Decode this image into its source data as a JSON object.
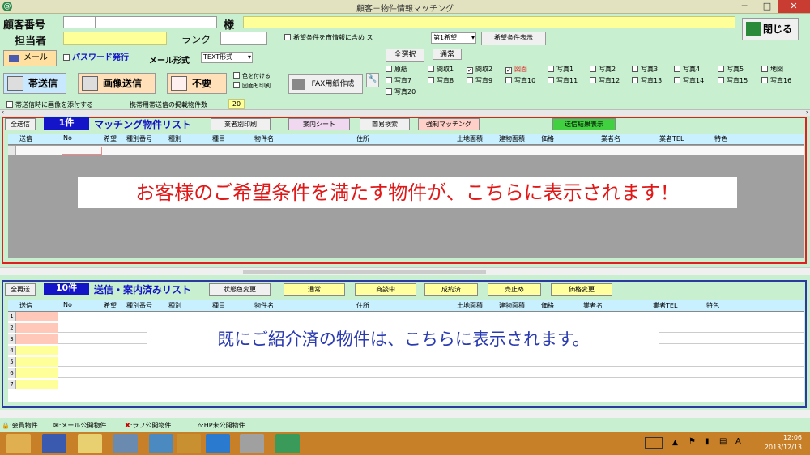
{
  "window": {
    "title": "顧客－物件情報マッチング",
    "min": "─",
    "max": "□",
    "close": "✕"
  },
  "header": {
    "customer_no_label": "顧客番号",
    "sama": "様",
    "tantou_label": "担当者",
    "rank_label": "ランク",
    "send_desired_all_label": "希望条件を市情報に含め ス",
    "priority_select": "第1希望",
    "show_desired_button": "希望条件表示",
    "close_button": "閉じる"
  },
  "mail": {
    "mail_button": "メール",
    "password_check": "パスワード発行",
    "format_label": "メール形式",
    "format_value": "TEXT形式"
  },
  "select_buttons": {
    "all": "全選択",
    "normal": "通常"
  },
  "actions": {
    "carrier_send": "帯送信",
    "image_send": "画像送信",
    "unneeded": "不要",
    "color_change": "色を付ける",
    "also_print": "図面も印刷",
    "fax_create": "FAX用紙作成",
    "attach_image_check": "帯送信時に画像を添付する",
    "mobile_count_label": "携帯用帯送信の掲載物件数",
    "mobile_count_value": "20"
  },
  "doc_checkboxes": [
    {
      "label": "原紙",
      "checked": false
    },
    {
      "label": "間取1",
      "checked": false
    },
    {
      "label": "間取2",
      "checked": true
    },
    {
      "label": "図面",
      "checked": true
    },
    {
      "label": "写真1",
      "checked": false
    },
    {
      "label": "写真2",
      "checked": false
    },
    {
      "label": "写真3",
      "checked": false
    },
    {
      "label": "写真4",
      "checked": false
    },
    {
      "label": "写真5",
      "checked": false
    },
    {
      "label": "地図",
      "checked": false
    },
    {
      "label": "写真7",
      "checked": false
    },
    {
      "label": "写真8",
      "checked": false
    },
    {
      "label": "写真9",
      "checked": false
    },
    {
      "label": "写真10",
      "checked": false
    },
    {
      "label": "写真11",
      "checked": false
    },
    {
      "label": "写真12",
      "checked": false
    },
    {
      "label": "写真13",
      "checked": false
    },
    {
      "label": "写真14",
      "checked": false
    },
    {
      "label": "写真15",
      "checked": false
    },
    {
      "label": "写真16",
      "checked": false
    },
    {
      "label": "写真20",
      "checked": false
    }
  ],
  "matching": {
    "all_send": "全送信",
    "count": "1件",
    "title": "マッチング物件リスト",
    "btn_trader_print": "業者別印刷",
    "btn_guide_sheet": "案内シート",
    "btn_simple_search": "簡易検索",
    "btn_force_match": "強制マッチング",
    "btn_send_result": "送信結果表示",
    "columns": [
      "送信",
      "No",
      "希望",
      "種別番号",
      "種別",
      "種目",
      "物件名",
      "住所",
      "土地面積",
      "建物面積",
      "価格",
      "業者名",
      "業者TEL",
      "特色"
    ],
    "overlay": "お客様のご希望条件を満たす物件が、こちらに表示されます！"
  },
  "sent": {
    "all_resend": "全再送",
    "count": "10件",
    "title": "送信・案内済みリスト",
    "btn_status_color": "状態色変更",
    "btn_normal": "通常",
    "btn_negotiating": "商談中",
    "btn_closed": "成約済",
    "btn_sold": "売止め",
    "btn_price_change": "価格変更",
    "columns": [
      "送信",
      "No",
      "希望",
      "種別番号",
      "種別",
      "種目",
      "物件名",
      "住所",
      "土地面積",
      "建物面積",
      "価格",
      "業者名",
      "業者TEL",
      "特色"
    ],
    "row_numbers": [
      "1",
      "2",
      "3",
      "4",
      "5",
      "6",
      "7"
    ],
    "overlay": "既にご紹介済の物件は、こちらに表示されます。"
  },
  "legend": [
    {
      "icon": "lock",
      "label": ":会員物件"
    },
    {
      "icon": "mail",
      "label": ":メール公開物件"
    },
    {
      "icon": "x",
      "label": ":ラフ公開物件"
    },
    {
      "icon": "house",
      "label": ":HP未公開物件"
    }
  ],
  "taskbar": {
    "time": "12:06",
    "date": "2013/12/13"
  },
  "colors": {
    "red_frame": "#e02020",
    "blue_frame": "#2a3aa0",
    "bg": "#c8f0d0",
    "yellow_field": "#ffff9a"
  }
}
